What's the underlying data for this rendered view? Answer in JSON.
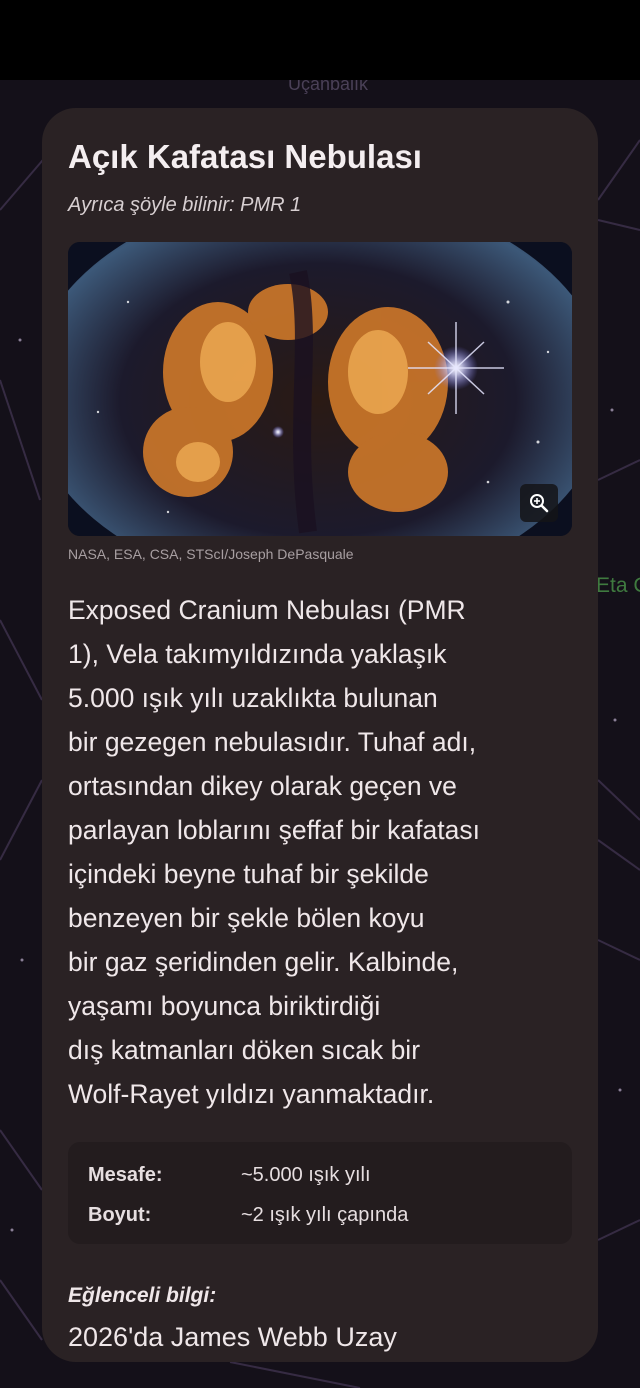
{
  "background": {
    "top_label": "Uçanbalık",
    "side_label": "Eta C"
  },
  "card": {
    "title": "Açık Kafatası Nebulası",
    "also_known": "Ayrıca şöyle bilinir: PMR 1",
    "image_credit": "NASA, ESA, CSA, STScI/Joseph DePasquale",
    "zoom_icon": "zoom-in-icon",
    "description_lines": [
      "Exposed Cranium Nebulası (PMR",
      "1), Vela takımyıldızında yaklaşık",
      "5.000 ışık yılı uzaklıkta bulunan",
      "bir gezegen nebulasıdır. Tuhaf adı,",
      "ortasından dikey olarak geçen ve",
      "parlayan loblarını şeffaf bir kafatası",
      "içindeki beyne tuhaf bir şekilde",
      "benzeyen bir şekle bölen koyu",
      "bir gaz şeridinden gelir. Kalbinde,",
      "yaşamı boyunca biriktirdiği",
      "dış katmanları döken sıcak bir",
      "Wolf-Rayet yıldızı yanmaktadır."
    ],
    "stats": [
      {
        "label": "Mesafe:",
        "value": "~5.000 ışık yılı"
      },
      {
        "label": "Boyut:",
        "value": "~2 ışık yılı çapında"
      }
    ],
    "fun_fact_label": "Eğlenceli bilgi:",
    "fun_fact_text": "2026'da James Webb Uzay"
  },
  "colors": {
    "card_bg": "#2a2224",
    "stats_bg": "#231c1e",
    "page_bg": "#141019",
    "accent_green": "#3f7a3f"
  }
}
